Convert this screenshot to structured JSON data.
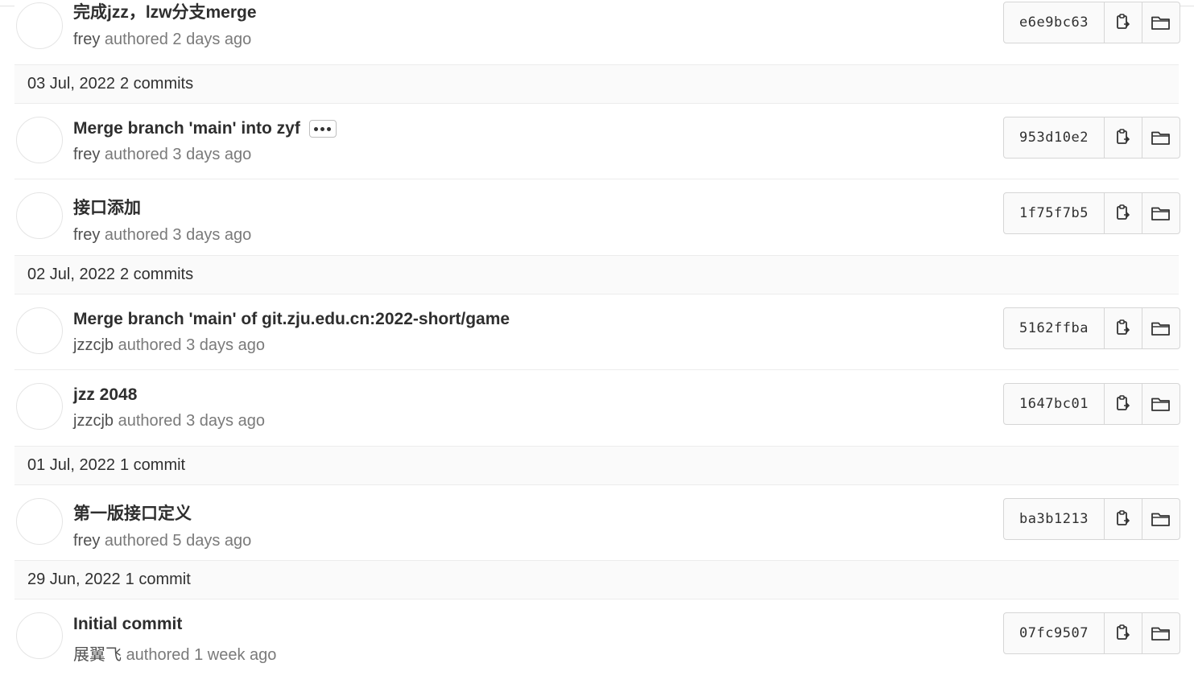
{
  "commit_groups": [
    {
      "date": "",
      "count": "",
      "commits": [
        {
          "title": "完成jzz，lzw分支merge",
          "author": "frey",
          "authored_text": "authored 2 days ago",
          "sha": "e6e9bc63",
          "has_more": false
        }
      ]
    },
    {
      "date": "03 Jul, 2022",
      "count": "2 commits",
      "commits": [
        {
          "title": "Merge branch 'main' into zyf",
          "author": "frey",
          "authored_text": "authored 3 days ago",
          "sha": "953d10e2",
          "has_more": true
        },
        {
          "title": "接口添加",
          "author": "frey",
          "authored_text": "authored 3 days ago",
          "sha": "1f75f7b5",
          "has_more": false
        }
      ]
    },
    {
      "date": "02 Jul, 2022",
      "count": "2 commits",
      "commits": [
        {
          "title": "Merge branch 'main' of git.zju.edu.cn:2022-short/game",
          "author": "jzzcjb",
          "authored_text": "authored 3 days ago",
          "sha": "5162ffba",
          "has_more": false
        },
        {
          "title": "jzz 2048",
          "author": "jzzcjb",
          "authored_text": "authored 3 days ago",
          "sha": "1647bc01",
          "has_more": false
        }
      ]
    },
    {
      "date": "01 Jul, 2022",
      "count": "1 commit",
      "commits": [
        {
          "title": "第一版接口定义",
          "author": "frey",
          "authored_text": "authored 5 days ago",
          "sha": "ba3b1213",
          "has_more": false
        }
      ]
    },
    {
      "date": "29 Jun, 2022",
      "count": "1 commit",
      "commits": [
        {
          "title": "Initial commit",
          "author": "展翼飞",
          "authored_text": "authored 1 week ago",
          "sha": "07fc9507",
          "has_more": false
        }
      ]
    }
  ],
  "icons": {
    "copy": "clipboard-icon",
    "browse": "folder-icon",
    "more": "ellipsis-icon"
  },
  "colors": {
    "header_bg": "#fafafa",
    "border": "#ececec",
    "muted_text": "#7a7a7a"
  }
}
